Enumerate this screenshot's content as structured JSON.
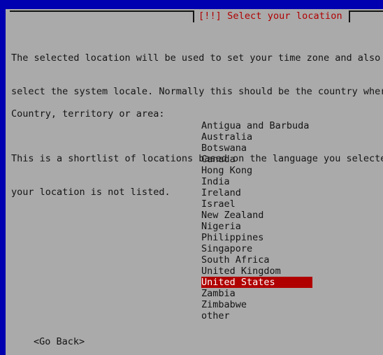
{
  "screen": {
    "backdrop_color": "#0000b0",
    "dialog_bg_color": "#aaaaaa",
    "text_color": "#141414",
    "accent_color": "#b00000",
    "selection_text_color": "#ffffff"
  },
  "titlebar": {
    "title": "[!!] Select your location"
  },
  "body": {
    "paragraph1_line1": "The selected location will be used to set your time zone and also",
    "paragraph1_line2": "select the system locale. Normally this should be the country wher",
    "paragraph2_line1": "This is a shortlist of locations based on the language you selecte",
    "paragraph2_line2": "your location is not listed."
  },
  "prompt": {
    "label": "Country, territory or area:"
  },
  "list": {
    "selected_index": 15,
    "items": [
      {
        "label": "Antigua and Barbuda",
        "selected": false
      },
      {
        "label": "Australia",
        "selected": false
      },
      {
        "label": "Botswana",
        "selected": false
      },
      {
        "label": "Canada",
        "selected": false
      },
      {
        "label": "Hong Kong",
        "selected": false
      },
      {
        "label": "India",
        "selected": false
      },
      {
        "label": "Ireland",
        "selected": false
      },
      {
        "label": "Israel",
        "selected": false
      },
      {
        "label": "New Zealand",
        "selected": false
      },
      {
        "label": "Nigeria",
        "selected": false
      },
      {
        "label": "Philippines",
        "selected": false
      },
      {
        "label": "Singapore",
        "selected": false
      },
      {
        "label": "South Africa",
        "selected": false
      },
      {
        "label": "United Kingdom",
        "selected": false
      },
      {
        "label": "United States",
        "selected": true
      },
      {
        "label": "Zambia",
        "selected": false
      },
      {
        "label": "Zimbabwe",
        "selected": false
      },
      {
        "label": "other",
        "selected": false
      }
    ]
  },
  "buttons": {
    "go_back": "<Go Back>"
  }
}
